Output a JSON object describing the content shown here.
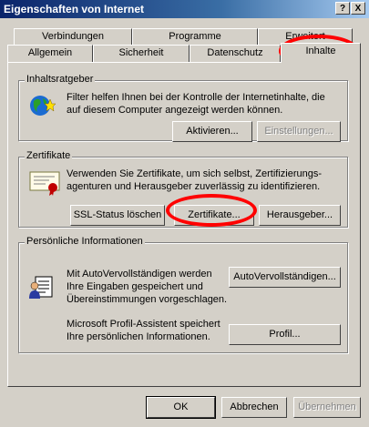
{
  "window": {
    "title": "Eigenschaften von Internet"
  },
  "titlebar_buttons": {
    "help": "?",
    "close": "X"
  },
  "tabs": {
    "row1": [
      "Verbindungen",
      "Programme",
      "Erweitert"
    ],
    "row2": [
      "Allgemein",
      "Sicherheit",
      "Datenschutz",
      "Inhalte"
    ],
    "active": "Inhalte"
  },
  "ratings": {
    "title": "Inhaltsratgeber",
    "text": "Filter helfen Ihnen bei der Kontrolle der Internetinhalte, die auf diesem Computer angezeigt werden können.",
    "activate": "Aktivieren...",
    "settings": "Einstellungen..."
  },
  "certificates": {
    "title": "Zertifikate",
    "text": "Verwenden Sie Zertifikate, um sich selbst, Zertifizierungs-agenturen und Herausgeber zuverlässig zu identifizieren.",
    "clear_ssl": "SSL-Status löschen",
    "certs": "Zertifikate...",
    "publishers": "Herausgeber..."
  },
  "personal": {
    "title": "Persönliche Informationen",
    "autocomplete_text": "Mit AutoVervollständigen werden Ihre Eingaben gespeichert und Übereinstimmungen vorgeschlagen.",
    "autocomplete_button": "AutoVervollständigen...",
    "profile_text": "Microsoft Profil-Assistent speichert Ihre persönlichen Informationen.",
    "profile_button": "Profil..."
  },
  "footer": {
    "ok": "OK",
    "cancel": "Abbrechen",
    "apply": "Übernehmen"
  },
  "colors": {
    "annotation": "#ff0000",
    "titlebar": "#0a246a",
    "face": "#d4d0c8"
  }
}
